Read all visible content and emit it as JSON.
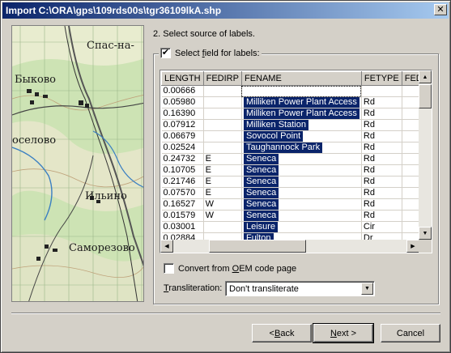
{
  "window": {
    "title": "Import C:\\ORA\\gps\\109rds00s\\tgr36109lkA.shp",
    "close_glyph": "✕"
  },
  "map": {
    "labels": [
      "Спас-на-",
      "Быково",
      "оселово",
      "Ильино",
      "Саморезово"
    ]
  },
  "step_label": "2. Select source of labels.",
  "select_field": {
    "checked": true,
    "check_glyph": "✔",
    "label_pre": "Select ",
    "label_u": "f",
    "label_post": "ield for labels:"
  },
  "grid": {
    "columns": [
      "LENGTH",
      "FEDIRP",
      "FENAME",
      "FETYPE",
      "FED"
    ],
    "rows": [
      [
        "0.00666",
        "",
        "",
        ""
      ],
      [
        "0.05980",
        "",
        "Milliken Power Plant Access",
        "Rd"
      ],
      [
        "0.16390",
        "",
        "Milliken Power Plant Access",
        "Rd"
      ],
      [
        "0.07912",
        "",
        "Milliken Station",
        "Rd"
      ],
      [
        "0.06679",
        "",
        "Sovocol Point",
        "Rd"
      ],
      [
        "0.02524",
        "",
        "Taughannock Park",
        "Rd"
      ],
      [
        "0.24732",
        "E",
        "Seneca",
        "Rd"
      ],
      [
        "0.10705",
        "E",
        "Seneca",
        "Rd"
      ],
      [
        "0.21746",
        "E",
        "Seneca",
        "Rd"
      ],
      [
        "0.07570",
        "E",
        "Seneca",
        "Rd"
      ],
      [
        "0.16527",
        "W",
        "Seneca",
        "Rd"
      ],
      [
        "0.01579",
        "W",
        "Seneca",
        "Rd"
      ],
      [
        "0.03001",
        "",
        "Leisure",
        "Cir"
      ],
      [
        "0.02884",
        "",
        "Fulton",
        "Dr"
      ]
    ],
    "scroll_up": "▲",
    "scroll_down": "▼",
    "scroll_left": "◀",
    "scroll_right": "▶"
  },
  "oem": {
    "checked": false,
    "label_pre": "Convert from ",
    "label_u": "O",
    "label_post": "EM code page"
  },
  "transliteration": {
    "label_u": "T",
    "label_post": "ransliteration:",
    "value": "Don't transliterate",
    "arrow": "▼"
  },
  "buttons": {
    "back": {
      "pre": "< ",
      "u": "B",
      "post": "ack"
    },
    "next": {
      "pre": "",
      "u": "N",
      "post": "ext >"
    },
    "cancel": "Cancel"
  },
  "colors": {
    "title_start": "#0a246a",
    "title_end": "#a6caf0",
    "selection": "#0a246a",
    "face": "#d4d0c8"
  }
}
